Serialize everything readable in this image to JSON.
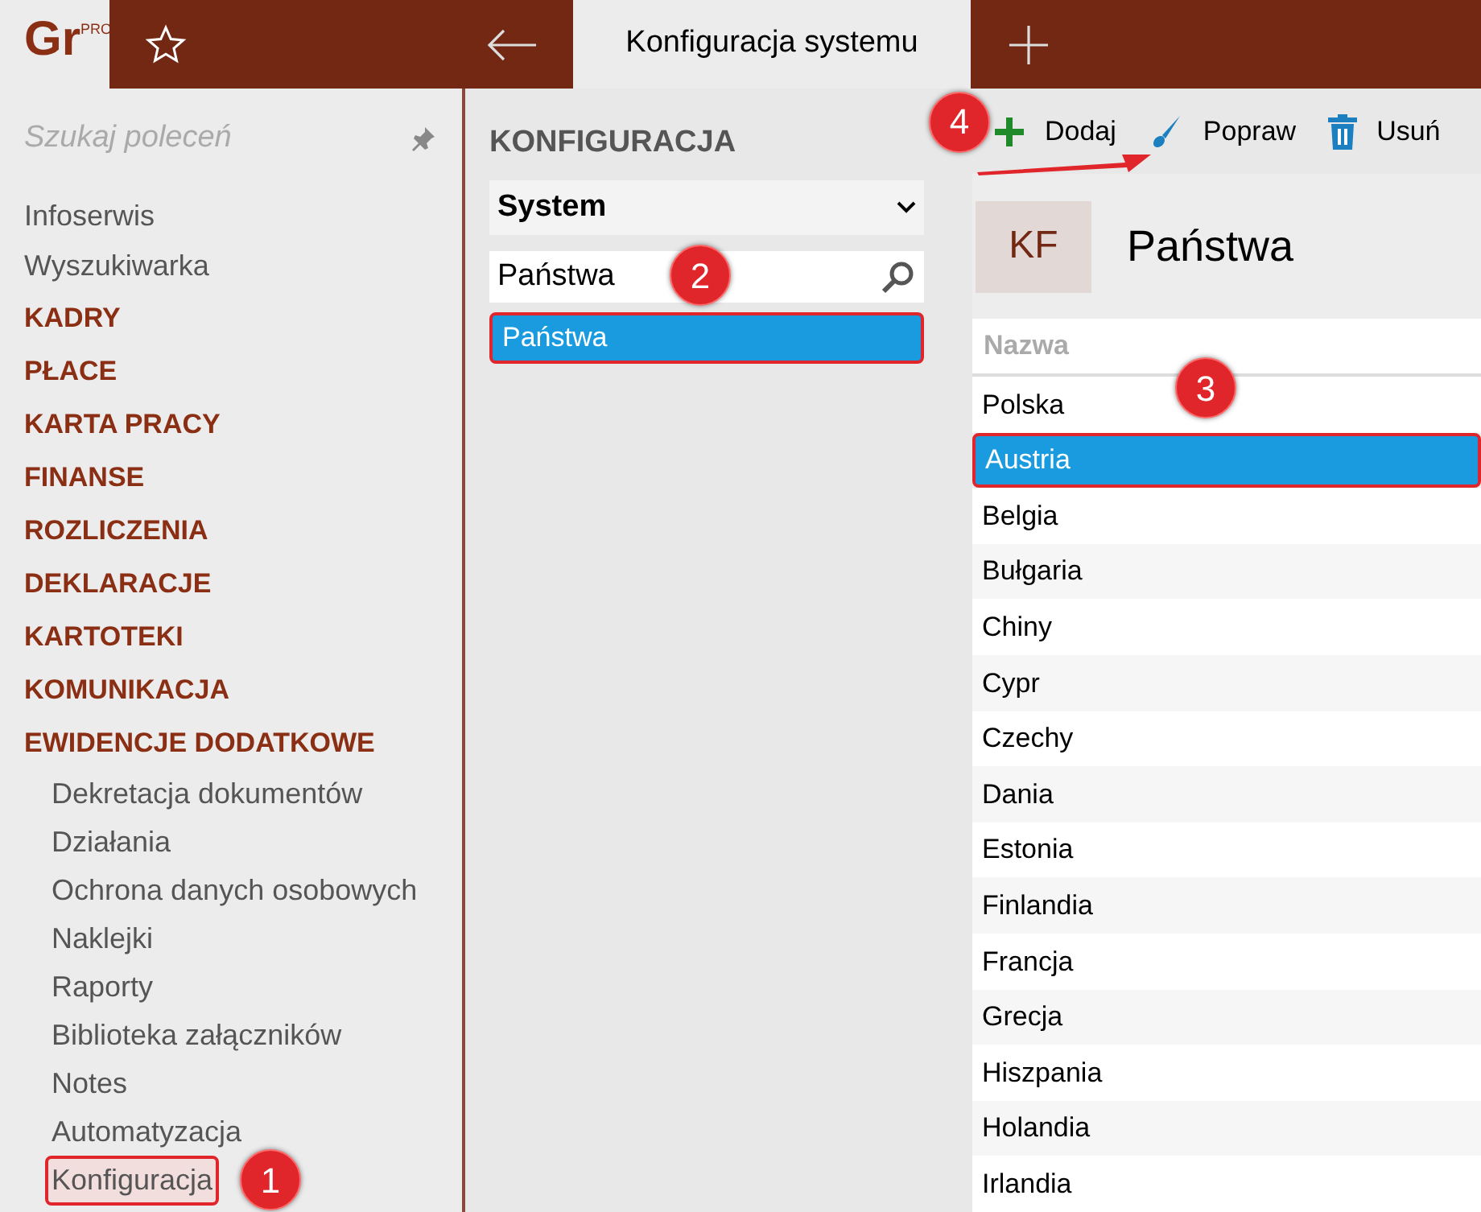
{
  "logo": {
    "text": "Gr",
    "badge": "PRO"
  },
  "tab": {
    "title": "Konfiguracja systemu"
  },
  "sidebar": {
    "search_placeholder": "Szukaj poleceń",
    "items": [
      {
        "label": "Infoserwis",
        "kind": "link"
      },
      {
        "label": "Wyszukiwarka",
        "kind": "link"
      },
      {
        "label": "KADRY",
        "kind": "section"
      },
      {
        "label": "PŁACE",
        "kind": "section"
      },
      {
        "label": "KARTA PRACY",
        "kind": "section"
      },
      {
        "label": "FINANSE",
        "kind": "section"
      },
      {
        "label": "ROZLICZENIA",
        "kind": "section"
      },
      {
        "label": "DEKLARACJE",
        "kind": "section"
      },
      {
        "label": "KARTOTEKI",
        "kind": "section"
      },
      {
        "label": "KOMUNIKACJA",
        "kind": "section"
      },
      {
        "label": "EWIDENCJE DODATKOWE",
        "kind": "section",
        "children": [
          {
            "label": "Dekretacja dokumentów",
            "highlighted": false
          },
          {
            "label": "Działania",
            "highlighted": false
          },
          {
            "label": "Ochrona danych osobowych",
            "highlighted": false
          },
          {
            "label": "Naklejki",
            "highlighted": false
          },
          {
            "label": "Raporty",
            "highlighted": false
          },
          {
            "label": "Biblioteka załączników",
            "highlighted": false
          },
          {
            "label": "Notes",
            "highlighted": false
          },
          {
            "label": "Automatyzacja",
            "highlighted": false
          },
          {
            "label": "Konfiguracja",
            "highlighted": true,
            "marker": "1"
          }
        ]
      }
    ]
  },
  "config": {
    "heading": "KONFIGURACJA",
    "dropdown": "System",
    "search": {
      "value": "Państwa",
      "marker": "2"
    },
    "results": [
      {
        "label": "Państwa",
        "selected": true,
        "highlighted": true
      }
    ]
  },
  "toolbar": [
    {
      "label": "Dodaj",
      "kind": "add",
      "marker": "4"
    },
    {
      "label": "Popraw",
      "kind": "edit"
    },
    {
      "label": "Usuń",
      "kind": "delete"
    }
  ],
  "detail": {
    "badge": "KF",
    "title": "Państwa",
    "column": "Nazwa",
    "column_marker": "3",
    "rows": [
      {
        "name": "Polska",
        "selected": false
      },
      {
        "name": "Austria",
        "selected": true
      },
      {
        "name": "Belgia",
        "selected": false
      },
      {
        "name": "Bułgaria",
        "selected": false
      },
      {
        "name": "Chiny",
        "selected": false
      },
      {
        "name": "Cypr",
        "selected": false
      },
      {
        "name": "Czechy",
        "selected": false
      },
      {
        "name": "Dania",
        "selected": false
      },
      {
        "name": "Estonia",
        "selected": false
      },
      {
        "name": "Finlandia",
        "selected": false
      },
      {
        "name": "Francja",
        "selected": false
      },
      {
        "name": "Grecja",
        "selected": false
      },
      {
        "name": "Hiszpania",
        "selected": false
      },
      {
        "name": "Holandia",
        "selected": false
      },
      {
        "name": "Irlandia",
        "selected": false
      }
    ]
  }
}
